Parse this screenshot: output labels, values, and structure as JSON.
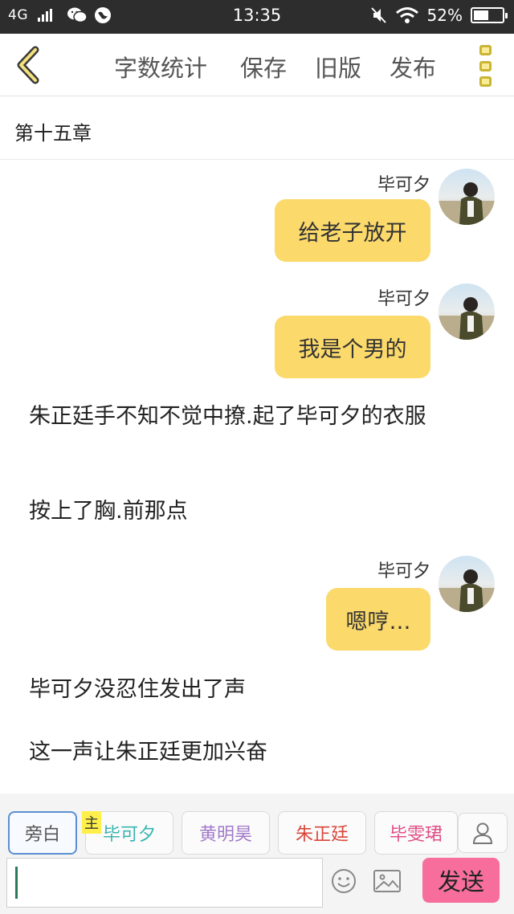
{
  "status_bar": {
    "network": "4G",
    "time": "13:35",
    "battery": "52%",
    "battery_level": 0.52
  },
  "toolbar": {
    "word_count": "字数统计",
    "save": "保存",
    "old_version": "旧版",
    "publish": "发布"
  },
  "chapter": {
    "title": "第十五章"
  },
  "messages": [
    {
      "type": "character",
      "sender": "毕可夕",
      "text": "给老子放开"
    },
    {
      "type": "character",
      "sender": "毕可夕",
      "text": "我是个男的"
    },
    {
      "type": "narration",
      "text": "朱正廷手不知不觉中撩.起了毕可夕的衣服"
    },
    {
      "type": "narration",
      "text": "按上了胸.前那点"
    },
    {
      "type": "character",
      "sender": "毕可夕",
      "text": "嗯哼…"
    },
    {
      "type": "narration",
      "text": "毕可夕没忍住发出了声"
    },
    {
      "type": "narration",
      "text": "这一声让朱正廷更加兴奋"
    }
  ],
  "characters": [
    {
      "name": "旁白",
      "color": "#555555"
    },
    {
      "name": "毕可夕",
      "color": "#3ab5b0",
      "tag": "主"
    },
    {
      "name": "黄明昊",
      "color": "#a27acb"
    },
    {
      "name": "朱正廷",
      "color": "#d9463a"
    },
    {
      "name": "毕雯珺",
      "color": "#e04f86"
    }
  ],
  "input": {
    "value": ""
  },
  "send_label": "发送",
  "colors": {
    "bubble": "#fbd96b",
    "accent": "#f8ec96",
    "send": "#f76e9d"
  }
}
